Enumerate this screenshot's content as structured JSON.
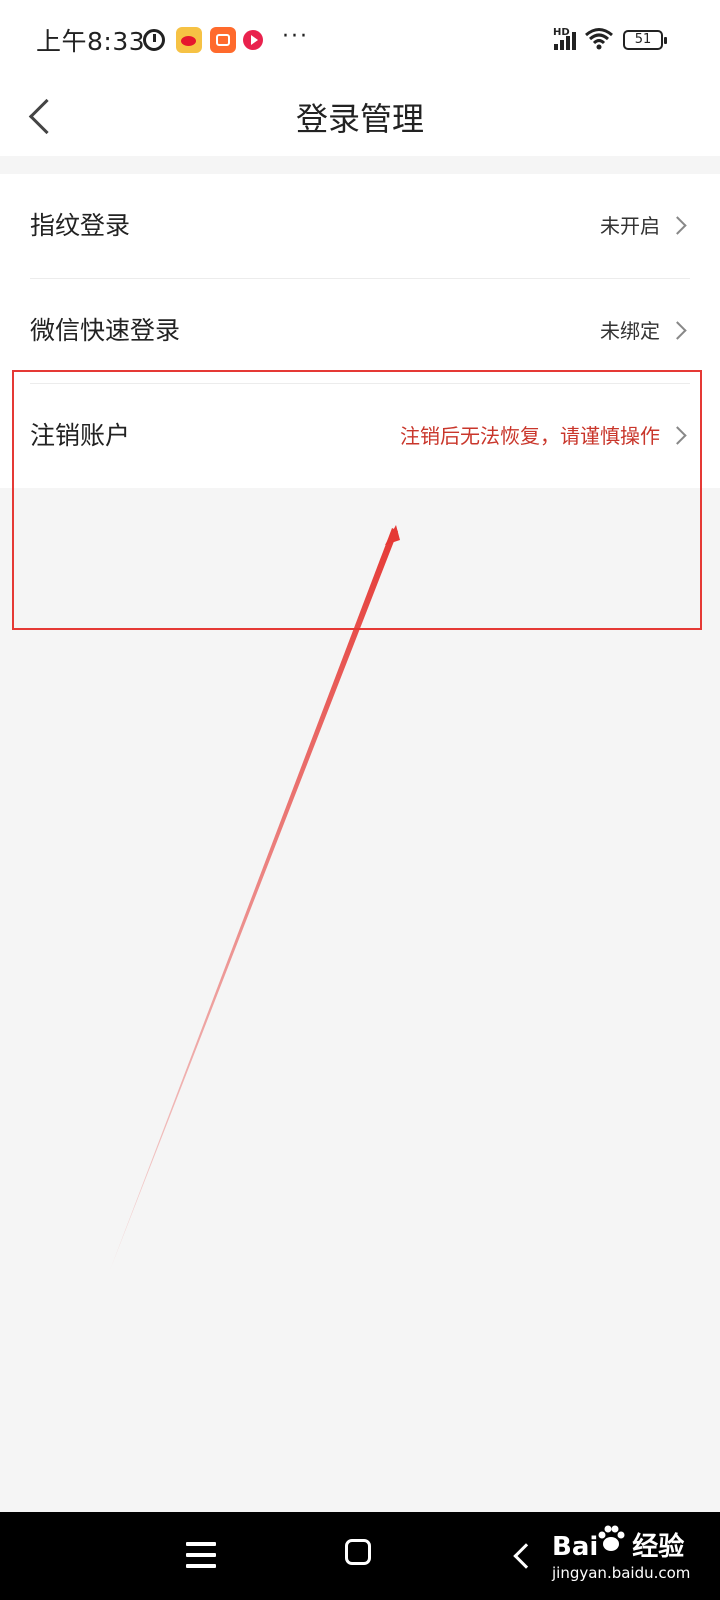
{
  "status_bar": {
    "time": "上午8:33",
    "network": "HD",
    "battery": "51"
  },
  "title_bar": {
    "title": "登录管理"
  },
  "list": [
    {
      "label": "指纹登录",
      "value": "未开启"
    },
    {
      "label": "微信快速登录",
      "value": "未绑定"
    },
    {
      "label": "注销账户",
      "value": "注销后无法恢复，请谨慎操作"
    }
  ],
  "colors": {
    "danger_text": "#c9362b",
    "annotation": "#e53935",
    "background": "#f5f5f5"
  },
  "watermark": {
    "brand": "Bai",
    "brand_suffix": "经验",
    "url": "jingyan.baidu.com"
  }
}
